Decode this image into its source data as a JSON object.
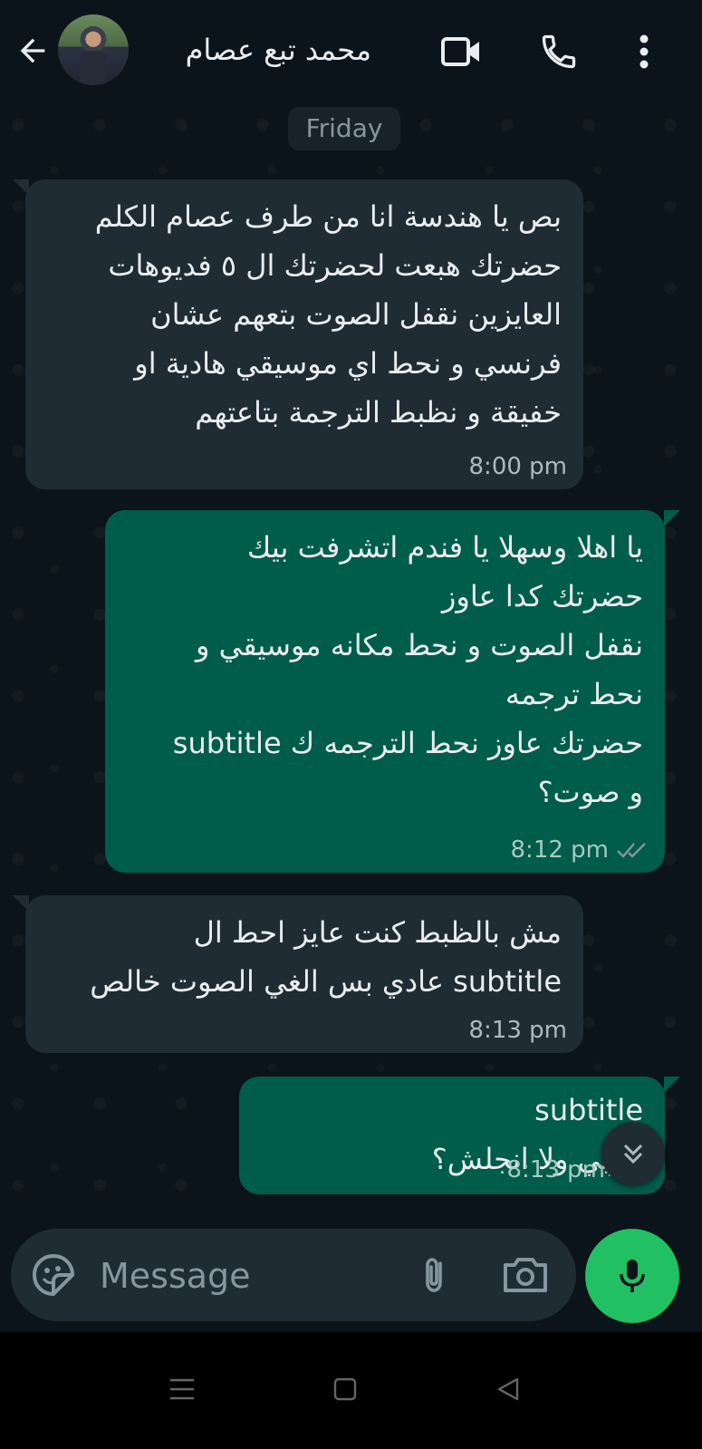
{
  "header": {
    "contact_name": "محمد تبع عصام",
    "icons": [
      "back-arrow-icon",
      "video-call-icon",
      "voice-call-icon",
      "more-vert-icon"
    ]
  },
  "chat": {
    "date_chip": "Friday",
    "messages": [
      {
        "direction": "incoming",
        "text": "بص يا هندسة انا من طرف عصام الكلم\nحضرتك هبعت لحضرتك ال ٥ فديوهات\nالعايزين نقفل الصوت بتعهم عشان\nفرنسي و نحط اي موسيقي هادية او\nخفيقة و نظبط الترجمة بتاعتهم",
        "time": "8:00 pm"
      },
      {
        "direction": "outgoing",
        "text": "يا اهلا وسهلا يا فندم اتشرفت بيك\nحضرتك كدا عاوز\nنقفل الصوت و نحط مكانه موسيقي و\nنحط ترجمه\nحضرتك عاوز نحط الترجمه ك subtitle\nو صوت؟",
        "time": "8:12 pm",
        "status": "read"
      },
      {
        "direction": "incoming",
        "text": "مش بالظبط كنت عايز احط ال\nsubtitle عادي بس الغي الصوت خالص",
        "time": "8:13 pm"
      },
      {
        "direction": "outgoing",
        "text": "subtitle\nعربي ولا انجلش؟",
        "time": "8:13 pm"
      }
    ]
  },
  "composer": {
    "placeholder": "Message"
  },
  "colors": {
    "background": "#0b141a",
    "incoming_bubble": "#1f2c34",
    "outgoing_bubble": "#005c4b",
    "accent_mic": "#21c063"
  }
}
